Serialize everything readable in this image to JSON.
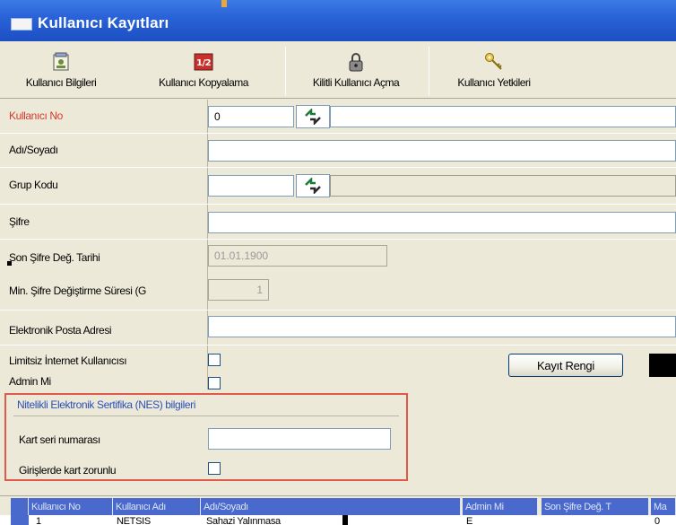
{
  "window": {
    "title": "Kullanıcı Kayıtları"
  },
  "toolbar": {
    "buttons": [
      {
        "label": "Kullanıcı Bilgileri",
        "icon": "user-info-icon"
      },
      {
        "label": "Kullanıcı Kopyalama",
        "icon": "copy-user-icon"
      },
      {
        "label": "Kilitli Kullanıcı Açma",
        "icon": "lock-icon"
      },
      {
        "label": "Kullanıcı Yetkileri",
        "icon": "key-icon"
      }
    ]
  },
  "form": {
    "kullanici_no": {
      "label": "Kullanıcı No",
      "value": "0"
    },
    "adi_soyadi": {
      "label": "Adı/Soyadı",
      "value": ""
    },
    "grup_kodu": {
      "label": "Grup Kodu",
      "value": ""
    },
    "sifre": {
      "label": "Şifre",
      "value": ""
    },
    "son_sifre": {
      "label": "Son Şifre Değ. Tarihi",
      "value": "01.01.1900"
    },
    "min_sifre": {
      "label": "Min. Şifre Değiştirme Süresi (G",
      "value": "1"
    },
    "eposta": {
      "label": "Elektronik Posta Adresi",
      "value": ""
    },
    "limitsiz": {
      "label": "Limitsiz İnternet Kullanıcısı",
      "checked": false
    },
    "admin": {
      "label": "Admin Mi",
      "checked": false
    },
    "kayit_rengi": {
      "label": "Kayıt Rengi",
      "color": "#000000"
    }
  },
  "nes": {
    "title": "Nitelikli Elektronik Sertifika (NES) bilgileri",
    "kart_seri": {
      "label": "Kart seri numarası",
      "value": ""
    },
    "girislerde": {
      "label": "Girişlerde kart zorunlu",
      "checked": false
    }
  },
  "grid": {
    "columns": [
      "Kullanıcı No",
      "Kullanıcı Adı",
      "Adı/Soyadı",
      "Admin Mi",
      "Son Şifre Değ. T",
      "Ma"
    ],
    "rows": [
      [
        "1",
        "NETSIS",
        "Sahazi Yalınmasa",
        "E",
        "",
        "0"
      ]
    ]
  },
  "colors": {
    "title_bar": "#2a63d8",
    "required_label": "#d8382c",
    "nes_border": "#e05a4c",
    "grid_header": "#4a69cc"
  }
}
